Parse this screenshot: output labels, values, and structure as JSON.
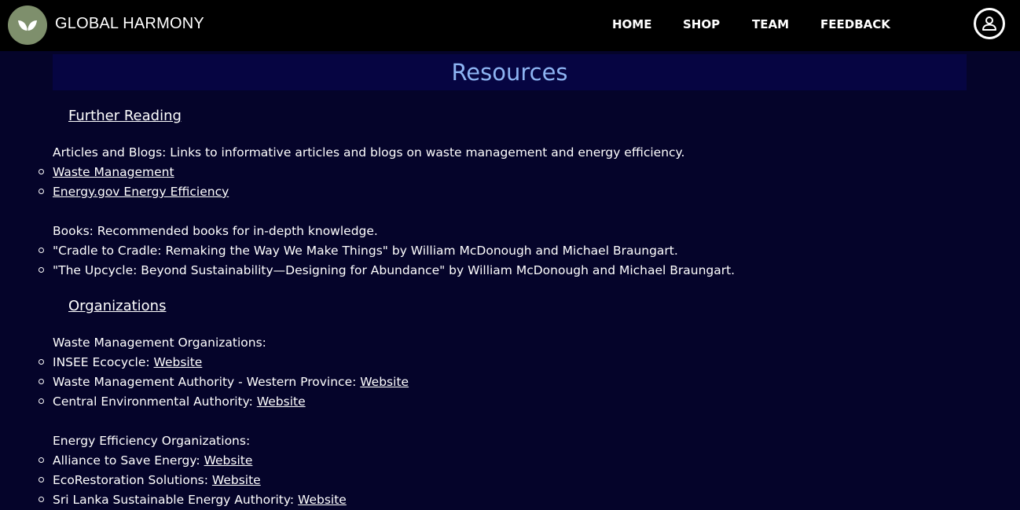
{
  "header": {
    "brand": "GLOBAL HARMONY",
    "nav": [
      "HOME",
      "SHOP",
      "TEAM",
      "FEEDBACK"
    ],
    "logo_icon": "leaf-logo-icon",
    "profile_icon": "user-icon"
  },
  "page": {
    "title": "Resources"
  },
  "further_reading": {
    "heading": "Further Reading",
    "articles_intro": "Articles and Blogs: Links to informative articles and blogs on waste management and energy efficiency.",
    "articles": [
      "Waste Management",
      "Energy.gov Energy Efficiency"
    ],
    "books_intro": "Books: Recommended books for in-depth knowledge.",
    "books": [
      "\"Cradle to Cradle: Remaking the Way We Make Things\" by William McDonough and Michael Braungart.",
      "\"The Upcycle: Beyond Sustainability—Designing for Abundance\" by William McDonough and Michael Braungart."
    ]
  },
  "organizations": {
    "heading": "Organizations",
    "waste_intro": "Waste Management Organizations:",
    "waste": [
      {
        "name": "INSEE Ecocycle: ",
        "link": "Website"
      },
      {
        "name": "Waste Management Authority - Western Province: ",
        "link": "Website"
      },
      {
        "name": "Central Environmental Authority: ",
        "link": "Website"
      }
    ],
    "energy_intro": "Energy Efficiency Organizations:",
    "energy": [
      {
        "name": "Alliance to Save Energy: ",
        "link": "Website"
      },
      {
        "name": "EcoRestoration Solutions: ",
        "link": "Website"
      },
      {
        "name": "Sri Lanka Sustainable Energy Authority: ",
        "link": "Website"
      }
    ]
  },
  "colors": {
    "background": "#05042a",
    "navbar": "#000000",
    "title_bar": "#060542",
    "title_text": "#8db4f2",
    "logo_bg": "#7e8f6c"
  }
}
